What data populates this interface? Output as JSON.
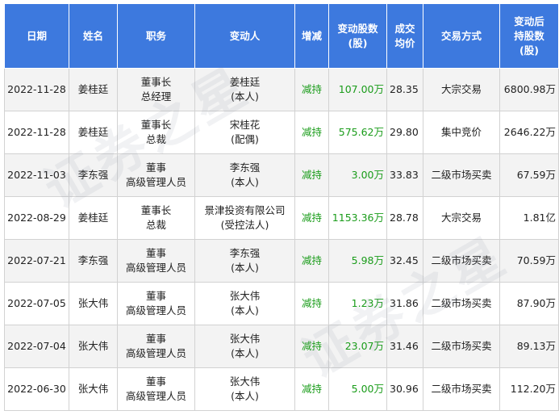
{
  "table": {
    "headers": {
      "date": "日期",
      "name": "姓名",
      "position": "职务",
      "changer": [
        "变动人"
      ],
      "direction": "增减",
      "shares_changed": [
        "变动股数",
        "(股)"
      ],
      "avg_price": [
        "成交",
        "均价"
      ],
      "method": "交易方式",
      "holding_after": [
        "变动后",
        "持股数",
        "(股)"
      ]
    },
    "rows": [
      {
        "date": "2022-11-28",
        "name": "姜桂廷",
        "position": [
          "董事长",
          "总经理"
        ],
        "changer": [
          "姜桂廷",
          "(本人)"
        ],
        "direction": "减持",
        "shares": "107.00万",
        "price": "28.35",
        "method": "大宗交易",
        "holding": "6800.98万"
      },
      {
        "date": "2022-11-28",
        "name": "姜桂廷",
        "position": [
          "董事长",
          "总裁"
        ],
        "changer": [
          "宋桂花",
          "(配偶)"
        ],
        "direction": "减持",
        "shares": "575.62万",
        "price": "29.80",
        "method": "集中竞价",
        "holding": "2646.22万"
      },
      {
        "date": "2022-11-03",
        "name": "李东强",
        "position": [
          "董事",
          "高级管理人员"
        ],
        "changer": [
          "李东强",
          "(本人)"
        ],
        "direction": "减持",
        "shares": "3.00万",
        "price": "33.83",
        "method": "二级市场买卖",
        "holding": "67.59万"
      },
      {
        "date": "2022-08-29",
        "name": "姜桂廷",
        "position": [
          "董事长",
          "总裁"
        ],
        "changer": [
          "景津投资有限公司",
          "(受控法人)"
        ],
        "direction": "减持",
        "shares": "1153.36万",
        "price": "28.78",
        "method": "大宗交易",
        "holding": "1.81亿"
      },
      {
        "date": "2022-07-21",
        "name": "李东强",
        "position": [
          "董事",
          "高级管理人员"
        ],
        "changer": [
          "李东强",
          "(本人)"
        ],
        "direction": "减持",
        "shares": "5.98万",
        "price": "32.45",
        "method": "二级市场买卖",
        "holding": "70.59万"
      },
      {
        "date": "2022-07-05",
        "name": "张大伟",
        "position": [
          "董事",
          "高级管理人员"
        ],
        "changer": [
          "张大伟",
          "(本人)"
        ],
        "direction": "减持",
        "shares": "1.23万",
        "price": "31.86",
        "method": "二级市场买卖",
        "holding": "87.90万"
      },
      {
        "date": "2022-07-04",
        "name": "张大伟",
        "position": [
          "董事",
          "高级管理人员"
        ],
        "changer": [
          "张大伟",
          "(本人)"
        ],
        "direction": "减持",
        "shares": "23.07万",
        "price": "31.46",
        "method": "二级市场买卖",
        "holding": "89.13万"
      },
      {
        "date": "2022-06-30",
        "name": "张大伟",
        "position": [
          "董事",
          "高级管理人员"
        ],
        "changer": [
          "张大伟",
          "(本人)"
        ],
        "direction": "减持",
        "shares": "5.00万",
        "price": "30.96",
        "method": "二级市场买卖",
        "holding": "112.20万"
      }
    ]
  },
  "watermark": "证券之星",
  "colors": {
    "header_bg": "#3d79de",
    "header_text": "#ffffff",
    "decrease_text": "#1a9c1a",
    "stripe_bg": "#f3f3f3",
    "border": "#d2d2d2"
  }
}
